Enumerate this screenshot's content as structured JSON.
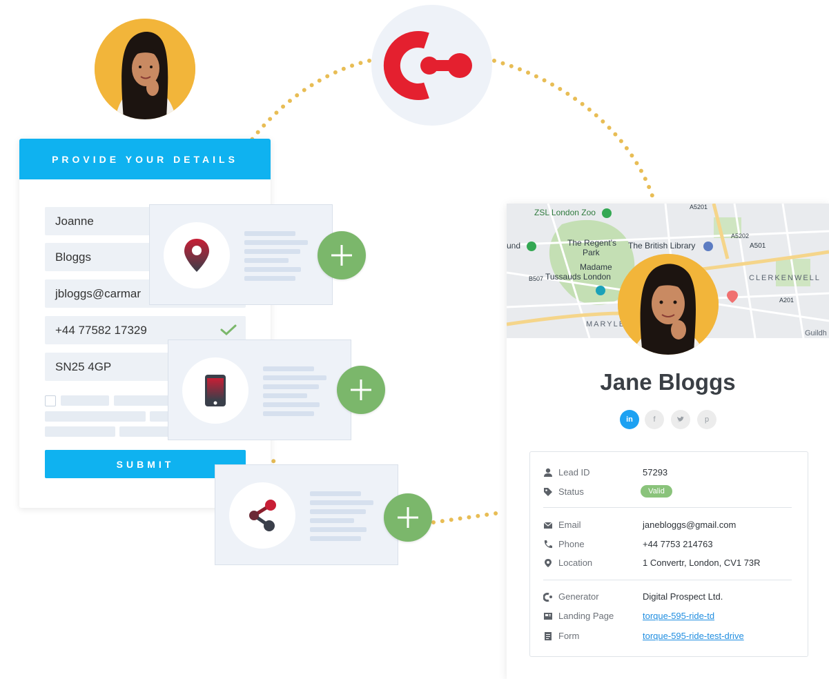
{
  "form": {
    "header": "PROVIDE YOUR DETAILS",
    "first_name": "Joanne",
    "last_name": "Bloggs",
    "email": "jbloggs@carmar",
    "phone": "+44 77582 17329",
    "postcode": "SN25 4GP",
    "submit_label": "SUBMIT"
  },
  "features": [
    {
      "icon": "location-pin-icon"
    },
    {
      "icon": "mobile-phone-icon"
    },
    {
      "icon": "share-icon"
    }
  ],
  "map": {
    "labels": {
      "zoo": "ZSL London Zoo",
      "park_line1": "The Regent's",
      "park_line2": "Park",
      "library": "The British Library",
      "madame_line1": "Madame",
      "madame_line2": "Tussauds London",
      "clerkenwell": "CLERKENWELL",
      "maryle": "MARYLE",
      "a501": "A501",
      "a5202": "A5202",
      "a201": "A201",
      "a5201": "A5201",
      "b507": "B507",
      "und": "und",
      "guildh": "Guildh"
    }
  },
  "profile": {
    "name": "Jane Bloggs",
    "social": [
      "in",
      "f",
      "tw",
      "p"
    ],
    "lead_id_label": "Lead ID",
    "lead_id": "57293",
    "status_label": "Status",
    "status": "Valid",
    "email_label": "Email",
    "email": "janebloggs@gmail.com",
    "phone_label": "Phone",
    "phone": "+44 7753 214763",
    "location_label": "Location",
    "location": "1 Convertr, London, CV1 73R",
    "generator_label": "Generator",
    "generator": "Digital Prospect Ltd.",
    "landing_label": "Landing Page",
    "landing": "torque-595-ride-td",
    "form_label": "Form",
    "form": "torque-595-ride-test-drive"
  },
  "colors": {
    "brand_blue": "#0fb2f0",
    "brand_red": "#e4202f",
    "plus_green": "#7bb76b",
    "dot_gold": "#e8bd55",
    "valid_green": "#8ac37b"
  }
}
